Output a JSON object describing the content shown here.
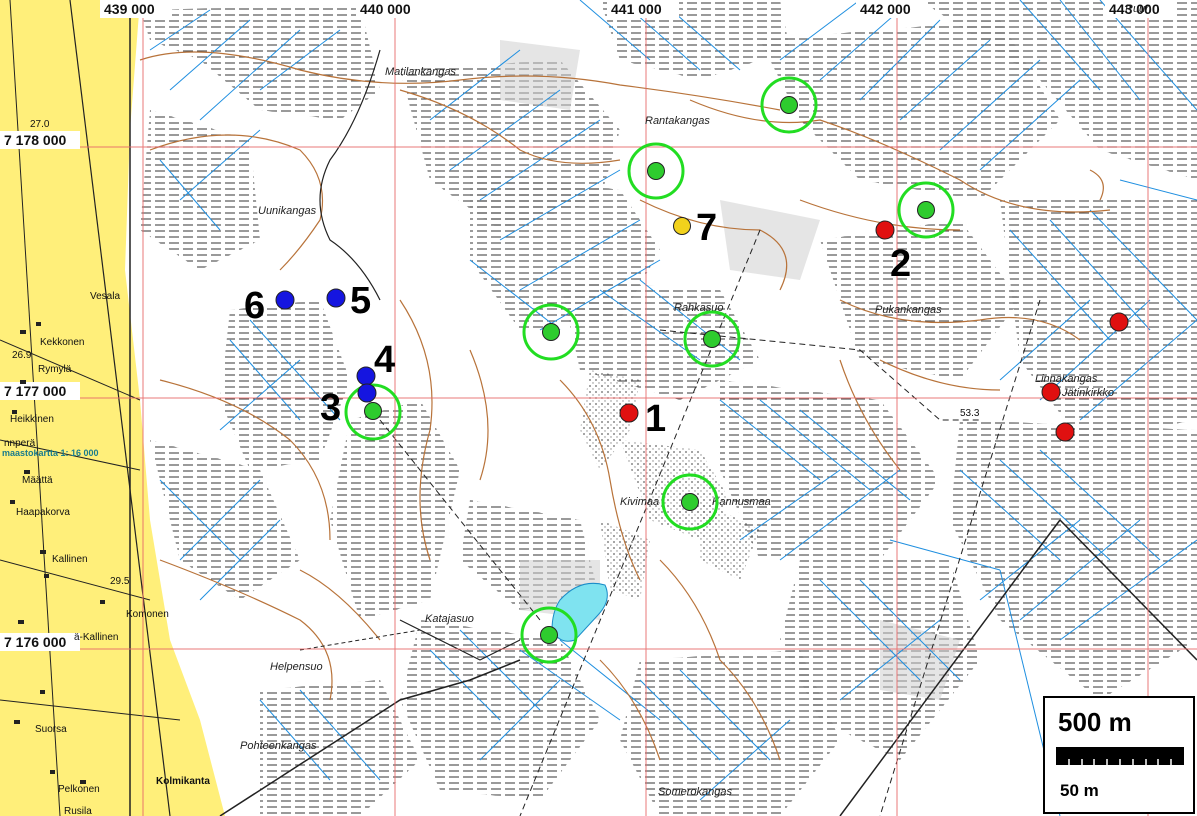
{
  "coordinates": {
    "easting": [
      "439 000",
      "440 000",
      "441 000",
      "442 000",
      "443 000"
    ],
    "northing": [
      "7 178 000",
      "7 177 000",
      "7 176 000"
    ]
  },
  "place_names": {
    "matilankangas": "Matilankangas",
    "rantakangas": "Rantakangas",
    "uunikangas": "Uunikangas",
    "rahkasuo": "Rahkasuo",
    "pukankangas": "Pukankangas",
    "linnakangas": "Linnakangas",
    "jatinkirkko": "Jätinkirkko",
    "kivimaa": "Kivimaa",
    "kannusmaa": "Kannusmaa",
    "katajasuo": "Katajasuo",
    "helpensuo": "Helpensuo",
    "pohteenkangas": "Pohteenkangas",
    "somerokangas": "Somerokangas",
    "ruun": "Ruun"
  },
  "villages": {
    "vesala": "Vesala",
    "kekkonen": "Kekkonen",
    "rymyla": "Rymylä",
    "heikkinen": "Heikkinen",
    "maatta": "Määttä",
    "haapakorva": "Haapakorva",
    "kallinen": "Kallinen",
    "komonen": "Komonen",
    "a_kallinen": "ä-Kallinen",
    "suorsa": "Suorsa",
    "kolmikanta": "Kolmikanta",
    "pelkonen": "Pelkonen",
    "rusila": "Rusila",
    "rajala": "nnperä"
  },
  "elevations": {
    "e1": "27.0",
    "e2": "26.9",
    "e3": "29.5",
    "e4": "53.3"
  },
  "map_note": "maastokartta 1: 16 000",
  "site_labels": {
    "s1": "1",
    "s2": "2",
    "s3": "3",
    "s4": "4",
    "s5": "5",
    "s6": "6",
    "s7": "7"
  },
  "scale_bar": {
    "main": "500 m",
    "sub": "50 m"
  },
  "marker_colors": {
    "red": "#e01010",
    "blue": "#1515e0",
    "green": "#2ecc2e",
    "yellow": "#f2d21c",
    "ring": "#22dd22"
  }
}
